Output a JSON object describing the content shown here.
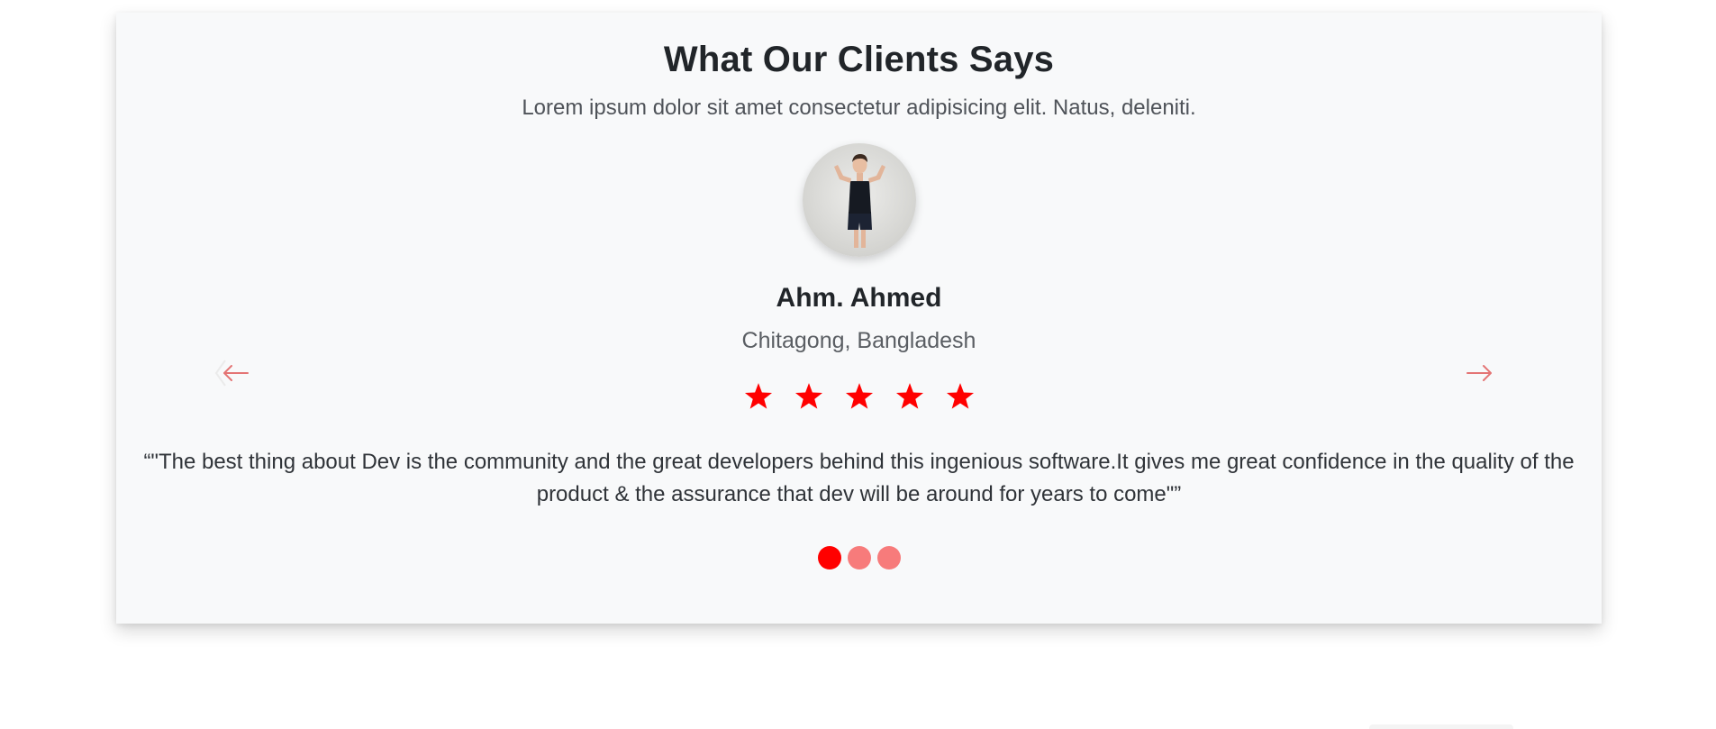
{
  "section": {
    "title": "What Our Clients Says",
    "subtitle": "Lorem ipsum dolor sit amet consectetur adipisicing elit. Natus, deleniti."
  },
  "testimonial": {
    "name": "Ahm. Ahmed",
    "location": "Chitagong, Bangladesh",
    "rating": 5,
    "rating_max": 5,
    "quote": "“\"The best thing about Dev is the community and the great developers behind this ingenious software.It gives me great confidence in the quality of the product & the assurance that dev will be around for years to come\"”",
    "avatar_icon": "client-photo"
  },
  "carousel": {
    "prev_icon": "arrow-left-icon",
    "next_icon": "arrow-right-icon",
    "slide_count": 3,
    "active_index": 0
  },
  "colors": {
    "accent": "#ff0000",
    "accent_light": "#f77b7b",
    "arrow": "#e47474",
    "card_bg": "#f8f9fa"
  }
}
